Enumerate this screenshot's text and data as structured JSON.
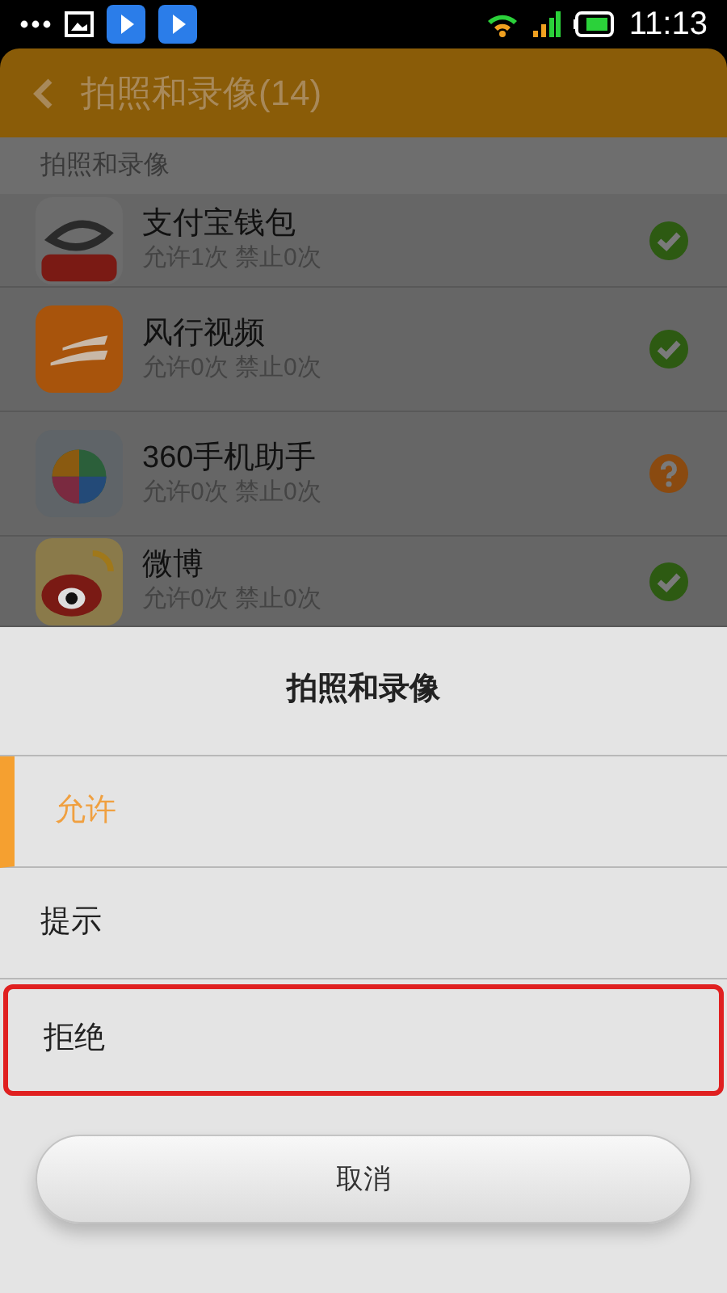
{
  "status_bar": {
    "time": "11:13"
  },
  "header": {
    "title": "拍照和录像(14)"
  },
  "section": {
    "title": "拍照和录像"
  },
  "apps": [
    {
      "name": "支付宝钱包",
      "stats": "允许1次 禁止0次",
      "kind": "check"
    },
    {
      "name": "风行视频",
      "stats": "允许0次 禁止0次",
      "kind": "check"
    },
    {
      "name": "360手机助手",
      "stats": "允许0次 禁止0次",
      "kind": "question"
    },
    {
      "name": "微博",
      "stats": "允许0次 禁止0次",
      "kind": "check"
    }
  ],
  "sheet": {
    "title": "拍照和录像",
    "options": [
      {
        "label": "允许",
        "selected": true,
        "highlighted": false
      },
      {
        "label": "提示",
        "selected": false,
        "highlighted": false
      },
      {
        "label": "拒绝",
        "selected": false,
        "highlighted": true
      }
    ],
    "cancel": "取消"
  }
}
